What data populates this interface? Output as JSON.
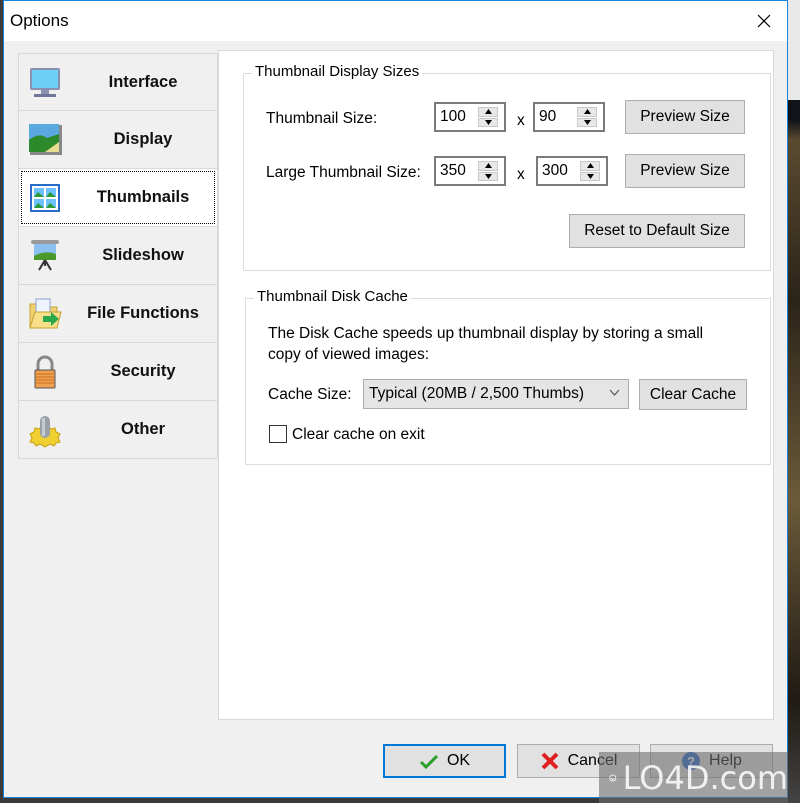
{
  "window": {
    "title": "Options",
    "close_label": "Close"
  },
  "sidebar": {
    "items": [
      {
        "label": "Interface",
        "icon": "monitor-icon",
        "active": false
      },
      {
        "label": "Display",
        "icon": "landscape-picture-icon",
        "active": false
      },
      {
        "label": "Thumbnails",
        "icon": "thumbnails-grid-icon",
        "active": true
      },
      {
        "label": "Slideshow",
        "icon": "projector-screen-icon",
        "active": false
      },
      {
        "label": "File Functions",
        "icon": "folder-arrow-icon",
        "active": false
      },
      {
        "label": "Security",
        "icon": "padlock-icon",
        "active": false
      },
      {
        "label": "Other",
        "icon": "gear-cylinder-icon",
        "active": false
      }
    ]
  },
  "display_sizes": {
    "group_title": "Thumbnail Display Sizes",
    "thumbnail_label": "Thumbnail Size:",
    "thumbnail_width": "100",
    "thumbnail_height": "90",
    "large_label": "Large Thumbnail Size:",
    "large_width": "350",
    "large_height": "300",
    "times": "x",
    "preview_label": "Preview Size",
    "reset_label": "Reset to Default Size"
  },
  "disk_cache": {
    "group_title": "Thumbnail Disk Cache",
    "description_line1": "The Disk Cache speeds up thumbnail display by storing a small",
    "description_line2": "copy of viewed images:",
    "cache_size_label": "Cache Size:",
    "cache_size_value": "Typical (20MB / 2,500 Thumbs)",
    "clear_cache_label": "Clear Cache",
    "clear_on_exit_label": "Clear cache on exit",
    "clear_on_exit_checked": false
  },
  "footer": {
    "ok_label": "OK",
    "cancel_label": "Cancel",
    "help_label": "Help"
  },
  "watermark": {
    "text": "LO4D.com"
  }
}
